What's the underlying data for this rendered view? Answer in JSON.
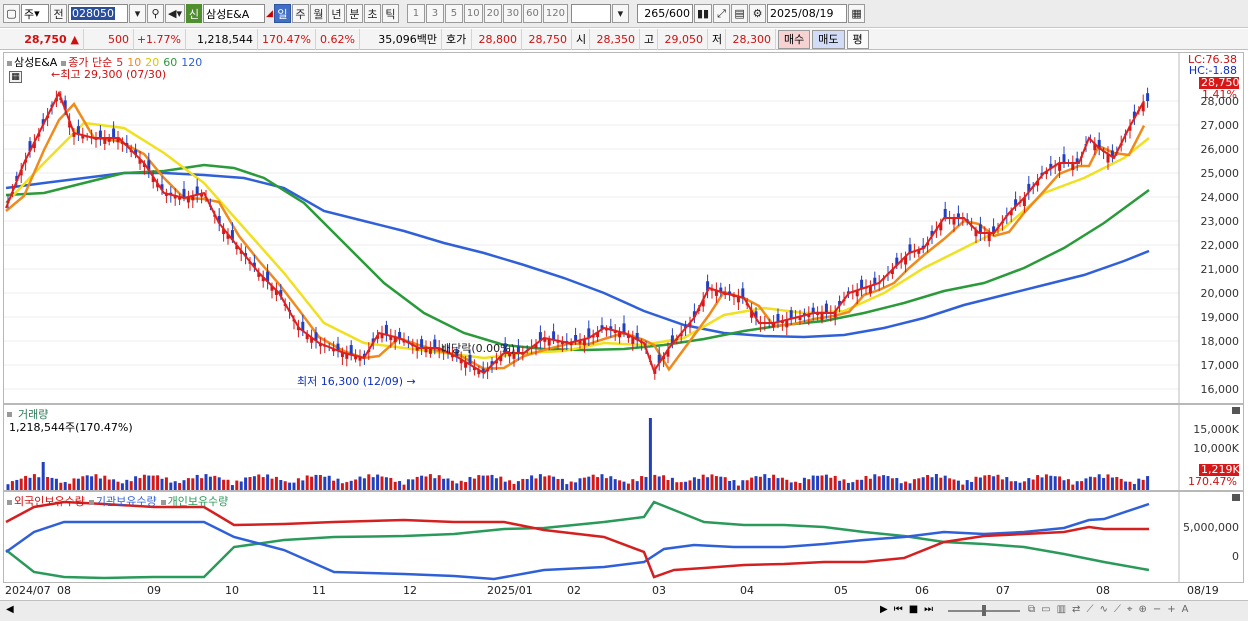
{
  "toolbar": {
    "market": "주",
    "jeon": "전",
    "code": "028050",
    "sin": "신",
    "stock_name": "삼성E&A",
    "periods": [
      "일",
      "주",
      "월",
      "년",
      "분",
      "초",
      "틱"
    ],
    "active_period": "일",
    "intervals": [
      "1",
      "3",
      "5",
      "10",
      "20",
      "30",
      "60",
      "120"
    ],
    "count_value": "265",
    "count_total": "/600",
    "date": "2025/08/19"
  },
  "quote": {
    "price": "28,750",
    "change": "500",
    "change_pct": "+1.77%",
    "volume": "1,218,544",
    "volume_ratio": "170.47%",
    "turnover": "0.62%",
    "amount": "35,096백만",
    "ask_label": "호가",
    "ask1": "28,800",
    "ask2": "28,750",
    "open_label": "시",
    "open": "28,350",
    "high_label": "고",
    "high": "29,050",
    "low_label": "저",
    "low": "28,300",
    "buy_button": "매수",
    "sell_button": "매도",
    "eval_button": "평"
  },
  "price_panel": {
    "name": "삼성E&A",
    "indicator_label": "종가 단순",
    "ma_periods": [
      "5",
      "10",
      "20",
      "60",
      "120"
    ],
    "ma_colors": [
      "#e02020",
      "#f08a1c",
      "#f0e020",
      "#2a9a3a",
      "#3060d8"
    ],
    "high_note": "최고 29,300 (07/30)",
    "low_note": "최저 16,300 (12/09)",
    "dividend_note": "배당락(0.00%)",
    "lc": "LC:76.38",
    "hc": "HC:-1.88",
    "current_tag": "28,750",
    "pct_tag": "1.41%",
    "y_ticks": [
      "28,000",
      "27,000",
      "26,000",
      "25,000",
      "24,000",
      "23,000",
      "22,000",
      "21,000",
      "20,000",
      "19,000",
      "18,000",
      "17,000",
      "16,000"
    ]
  },
  "volume_panel": {
    "title": "거래량",
    "value": "1,218,544주(170.47%)",
    "y_ticks": [
      "15,000K",
      "10,000K"
    ],
    "current_tag": "1,219K",
    "pct_tag": "170.47%"
  },
  "holding_panel": {
    "series": [
      "외국인보유수량",
      "기관보유수량",
      "개인보유수량"
    ],
    "series_colors": [
      "#d42020",
      "#3060d8",
      "#2a9a5a"
    ],
    "y_ticks": [
      "5,000,000",
      "0"
    ]
  },
  "x_axis": [
    "2024/07",
    "08",
    "09",
    "10",
    "11",
    "12",
    "2025/01",
    "02",
    "03",
    "04",
    "05",
    "06",
    "07",
    "08",
    "08/19"
  ]
}
